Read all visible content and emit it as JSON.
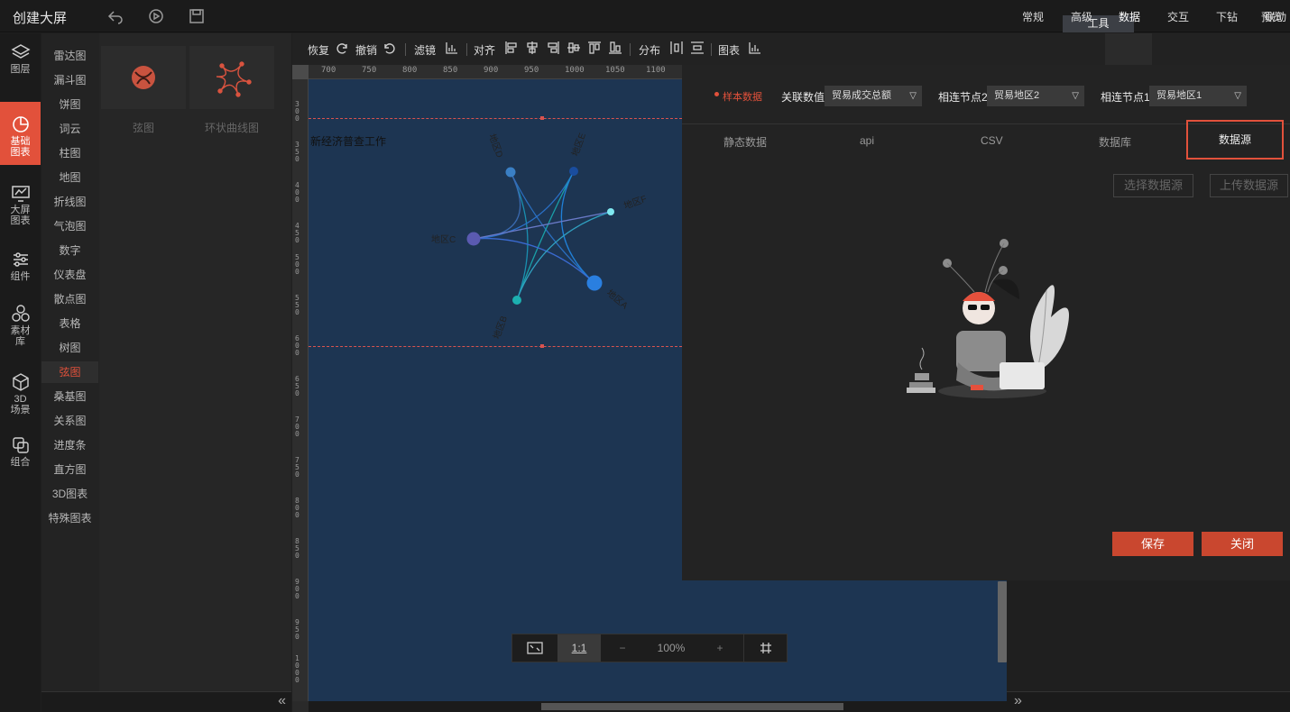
{
  "header": {
    "title": "创建大屏",
    "preview": "预览",
    "tools_tab": "工具",
    "icons": [
      "undo-icon",
      "play-icon",
      "save-icon"
    ]
  },
  "leftnav": {
    "items": [
      {
        "label": "图层",
        "icon": "layers-icon"
      },
      {
        "label": "基础\n图表",
        "icon": "pie-chart-icon",
        "active": true
      },
      {
        "label": "大屏\n图表",
        "icon": "screen-chart-icon"
      },
      {
        "label": "组件",
        "icon": "sliders-icon"
      },
      {
        "label": "素材\n库",
        "icon": "hexagons-icon"
      },
      {
        "label": "3D\n场景",
        "icon": "cube-icon"
      },
      {
        "label": "组合",
        "icon": "combine-icon"
      }
    ],
    "active_color": "#e2513b"
  },
  "categories": [
    "雷达图",
    "漏斗图",
    "饼图",
    "词云",
    "柱图",
    "地图",
    "折线图",
    "气泡图",
    "数字",
    "仪表盘",
    "散点图",
    "表格",
    "树图",
    "弦图",
    "桑基图",
    "关系图",
    "进度条",
    "直方图",
    "3D图表",
    "特殊图表"
  ],
  "active_category": "弦图",
  "thumbnails": [
    {
      "label": "弦图",
      "icon": "chord-thumb-icon"
    },
    {
      "label": "环状曲线图",
      "icon": "ring-curve-thumb-icon"
    }
  ],
  "toolbar": {
    "redo": "恢复",
    "undo": "撤销",
    "filter": "滤镜",
    "align": "对齐",
    "distribute": "分布",
    "chart": "图表",
    "prop_tabs": [
      "常规",
      "高级",
      "数据",
      "交互",
      "下钻",
      "联动"
    ],
    "active_prop_tab": "数据"
  },
  "ruler": {
    "top": [
      "700",
      "750",
      "800",
      "850",
      "900",
      "950",
      "1000",
      "1050",
      "1100"
    ],
    "left": [
      "300",
      "350",
      "400",
      "450",
      "500",
      "550",
      "600",
      "650",
      "700",
      "750",
      "800",
      "850",
      "900",
      "950",
      "1000"
    ]
  },
  "stage": {
    "title": "新经济普查工作",
    "bg": "#1d3552",
    "chord_nodes": [
      {
        "label": "地区D",
        "color": "#3a7fc4"
      },
      {
        "label": "地区E",
        "color": "#1a4d9e"
      },
      {
        "label": "地区F",
        "color": "#7fe8f0"
      },
      {
        "label": "地区C",
        "color": "#5a5ab0"
      },
      {
        "label": "地区A",
        "color": "#2a7fe0"
      },
      {
        "label": "地区B",
        "color": "#1cb0b0"
      }
    ]
  },
  "zoom": {
    "fit_icon": "fit-screen-icon",
    "one_to_one": "1:1",
    "minus": "−",
    "value": "100%",
    "plus": "+",
    "grid_icon": "grid-icon"
  },
  "panel": {
    "sample_data": "样本数据",
    "field1_label": "关联数值",
    "field1_value": "贸易成交总额",
    "field2_label": "相连节点2",
    "field2_value": "贸易地区2",
    "field3_label": "相连节点1",
    "field3_value": "贸易地区1",
    "ds_tabs": [
      "静态数据",
      "api",
      "CSV",
      "数据库",
      "数据源"
    ],
    "active_ds_tab": "数据源",
    "select_ds": "选择数据源",
    "upload_ds": "上传数据源",
    "save": "保存",
    "close": "关闭",
    "illustration": "person-with-laptop-illustration"
  }
}
